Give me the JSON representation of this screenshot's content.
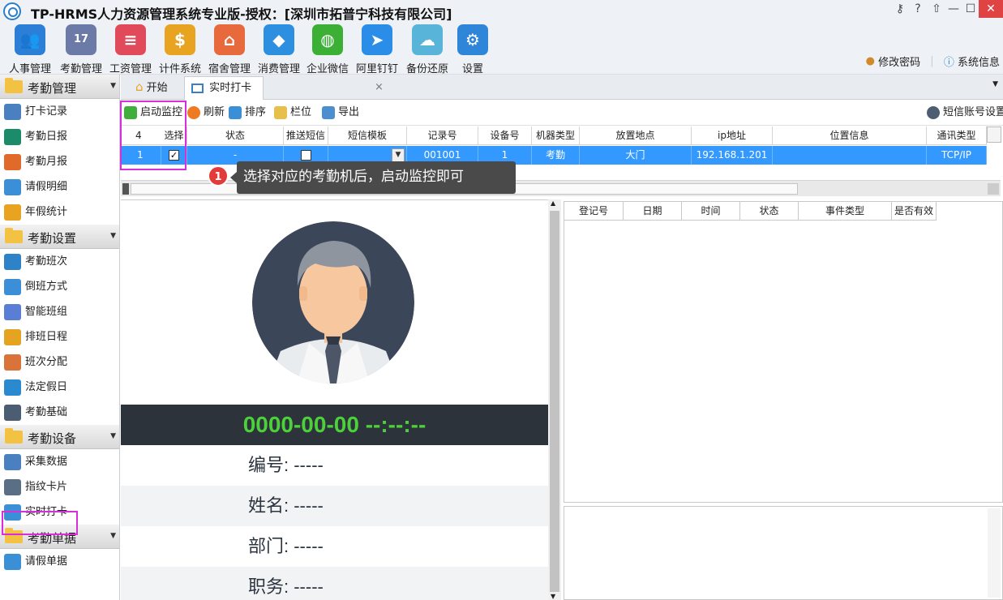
{
  "window": {
    "title": "TP-HRMS人力资源管理系统专业版-授权：[深圳市拓普宁科技有限公司]",
    "controls": [
      "key-icon",
      "help-icon",
      "pin-icon",
      "minimize-icon",
      "maximize-icon",
      "close-icon"
    ]
  },
  "toolbar": {
    "items": [
      {
        "label": "人事管理",
        "icon": "people-icon",
        "color": "#2b7fd6"
      },
      {
        "label": "考勤管理",
        "icon": "calendar-icon",
        "color": "#6c7aa8"
      },
      {
        "label": "工资管理",
        "icon": "ledger-icon",
        "color": "#e04a5a"
      },
      {
        "label": "计件系统",
        "icon": "money-bag-icon",
        "color": "#e8a321"
      },
      {
        "label": "宿舍管理",
        "icon": "house-gear-icon",
        "color": "#e8693b"
      },
      {
        "label": "消费管理",
        "icon": "cubes-icon",
        "color": "#2d8fe0"
      },
      {
        "label": "企业微信",
        "icon": "wechat-icon",
        "color": "#3cb035"
      },
      {
        "label": "阿里钉钉",
        "icon": "dingtalk-icon",
        "color": "#2a8de8"
      },
      {
        "label": "备份还原",
        "icon": "cloud-icon",
        "color": "#58b4d8"
      },
      {
        "label": "设置",
        "icon": "settings-icon",
        "color": "#2f86d8"
      }
    ],
    "change_password": "修改密码",
    "system_info": "系统信息"
  },
  "sidebar": {
    "groups": [
      {
        "label": "考勤管理",
        "items": [
          "打卡记录",
          "考勤日报",
          "考勤月报",
          "请假明细",
          "年假统计"
        ]
      },
      {
        "label": "考勤设置",
        "items": [
          "考勤班次",
          "倒班方式",
          "智能班组",
          "排班日程",
          "班次分配",
          "法定假日",
          "考勤基础"
        ]
      },
      {
        "label": "考勤设备",
        "items": [
          "采集数据",
          "指纹卡片",
          "实时打卡"
        ]
      },
      {
        "label": "考勤单据",
        "items": [
          "请假单据"
        ]
      }
    ]
  },
  "tabs": {
    "start": "开始",
    "realtime": "实时打卡"
  },
  "subtoolbar": {
    "start_monitor": "启动监控",
    "refresh": "刷新",
    "sort": "排序",
    "columns": "栏位",
    "export": "导出",
    "sms_account": "短信账号设置"
  },
  "grid": {
    "count": "4",
    "headers": [
      "选择",
      "状态",
      "推送短信",
      "短信模板",
      "记录号",
      "设备号",
      "机器类型",
      "放置地点",
      "ip地址",
      "位置信息",
      "通讯类型"
    ],
    "row": {
      "num": "1",
      "selected": true,
      "status": "-",
      "push_sms": false,
      "sms_template": "",
      "record_no": "001001",
      "device_no": "1",
      "machine_type": "考勤",
      "location": "大门",
      "ip": "192.168.1.201",
      "position_info": "",
      "comm_type": "TCP/IP"
    }
  },
  "callout": {
    "number": "1",
    "text": "选择对应的考勤机后，启动监控即可"
  },
  "profile": {
    "datetime": "0000-00-00 --:--:--",
    "id": "编号: -----",
    "name": "姓名: -----",
    "dept": "部门: -----",
    "position": "职务: -----"
  },
  "events": {
    "headers": [
      "登记号",
      "日期",
      "时间",
      "状态",
      "事件类型",
      "是否有效"
    ]
  }
}
